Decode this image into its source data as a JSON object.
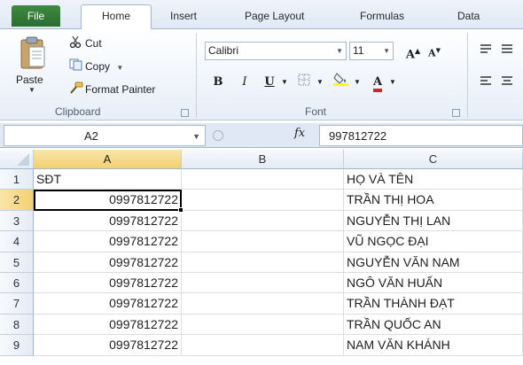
{
  "tabs": [
    "File",
    "Home",
    "Insert",
    "Page Layout",
    "Formulas",
    "Data"
  ],
  "ribbon": {
    "clipboard": {
      "paste_label": "Paste",
      "cut_label": "Cut",
      "copy_label": "Copy",
      "format_painter_label": "Format Painter",
      "group_label": "Clipboard"
    },
    "font": {
      "font_name": "Calibri",
      "font_size": "11",
      "bold": "B",
      "italic": "I",
      "underline": "U",
      "grow": "A",
      "shrink": "A",
      "font_color": "A",
      "group_label": "Font"
    }
  },
  "formula_bar": {
    "name_box": "A2",
    "fx": "fx",
    "value": "997812722"
  },
  "grid": {
    "corner": "",
    "columns": [
      "A",
      "B",
      "C"
    ],
    "rows": [
      {
        "num": "1",
        "A": "SĐT",
        "B": "",
        "C": "HỌ VÀ TÊN"
      },
      {
        "num": "2",
        "A": "0997812722",
        "B": "",
        "C": "TRẦN THỊ HOA"
      },
      {
        "num": "3",
        "A": "0997812722",
        "B": "",
        "C": "NGUYỄN THỊ LAN"
      },
      {
        "num": "4",
        "A": "0997812722",
        "B": "",
        "C": "VŨ NGỌC ĐẠI"
      },
      {
        "num": "5",
        "A": "0997812722",
        "B": "",
        "C": "NGUYỄN VĂN NAM"
      },
      {
        "num": "6",
        "A": "0997812722",
        "B": "",
        "C": "NGÔ VĂN HUẤN"
      },
      {
        "num": "7",
        "A": "0997812722",
        "B": "",
        "C": "TRẦN THÀNH ĐẠT"
      },
      {
        "num": "8",
        "A": "0997812722",
        "B": "",
        "C": "TRẦN QUỐC AN"
      },
      {
        "num": "9",
        "A": "0997812722",
        "B": "",
        "C": "NAM VĂN KHÁNH"
      }
    ],
    "active_cell": "A2"
  },
  "colors": {
    "file_tab": "#2f7a33",
    "selection_header": "#f3d072",
    "font_color_underline": "#e02020",
    "highlight_underline": "#ffff00"
  }
}
